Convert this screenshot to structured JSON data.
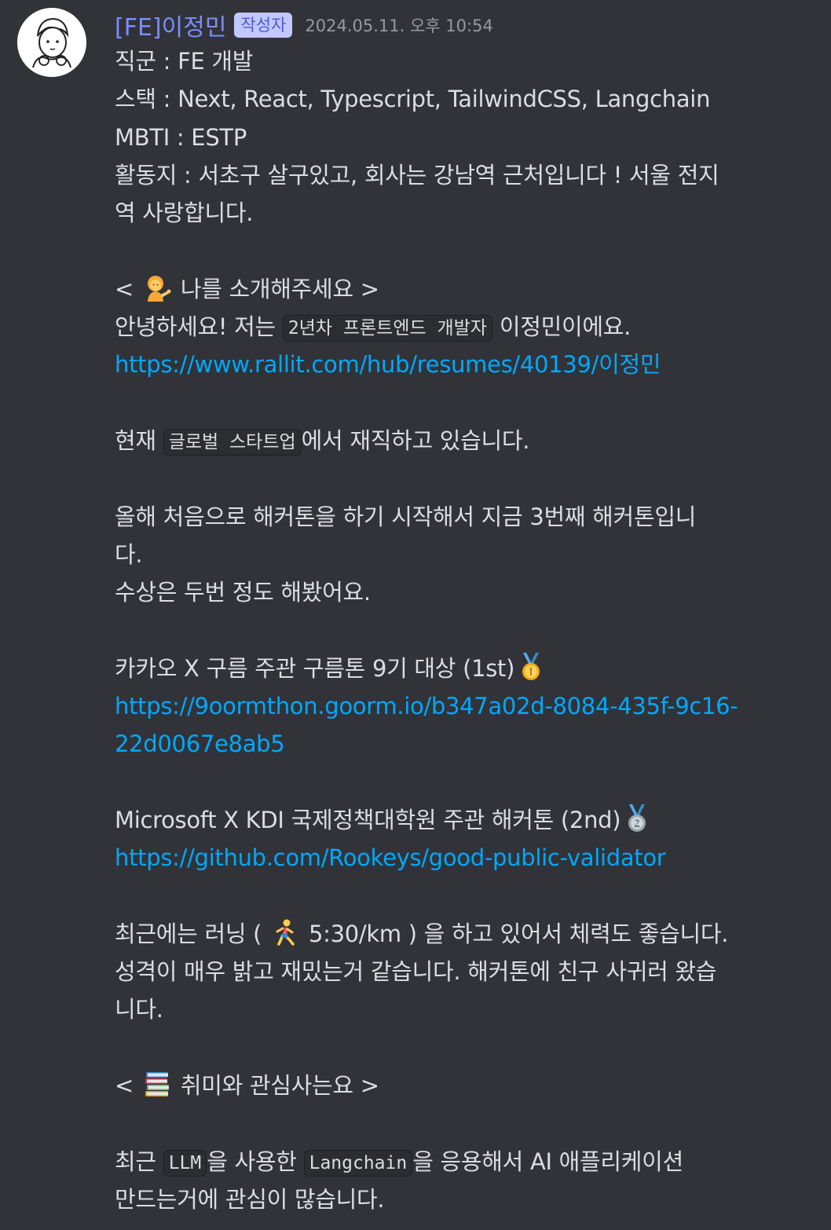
{
  "author": {
    "name": "[FE]이정민",
    "badge": "작성자",
    "timestamp": "2024.05.11. 오후 10:54",
    "color": "#7a8dff"
  },
  "profile": {
    "job": "직군 : FE 개발",
    "stack": "스택 : Next, React, Typescript, TailwindCSS, Langchain",
    "mbti": "MBTI : ESTP",
    "area_1": "활동지 : 서초구 살구있고, 회사는 강남역 근처입니다 ! 서울 전지",
    "area_2": "역 사랑합니다."
  },
  "intro": {
    "heading_prefix": "< ",
    "heading_icon": "person-tipping-hand-emoji",
    "heading_text": " 나를 소개해주세요 >",
    "greet_before": "안녕하세요! 저는 ",
    "greet_code": "2년차 프론트엔드 개발자",
    "greet_after": " 이정민이에요.",
    "resume_link": "https://www.rallit.com/hub/resumes/40139/이정민",
    "work_before": "현재 ",
    "work_code": "글로벌 스타트업",
    "work_after": "에서 재직하고 있습니다.",
    "hack_1": "올해 처음으로 해커톤을 하기 시작해서 지금 3번째 해커톤입니",
    "hack_2": "다.",
    "hack_3": " 수상은 두번 정도 해봤어요."
  },
  "awards": [
    {
      "title": "카카오 X 구름 주관 구름톤 9기 대상 (1st)",
      "icon": "gold-medal-emoji",
      "link_1": "https://9oormthon.goorm.io/b347a02d-8084-435f-9c16-",
      "link_2": "22d0067e8ab5"
    },
    {
      "title": "Microsoft X KDI 국제정책대학원 주관 해커톤 (2nd)",
      "icon": "silver-medal-emoji",
      "link_1": "https://github.com/Rookeys/good-public-validator"
    }
  ],
  "running": {
    "before": "최근에는 러닝 ( ",
    "icon": "runner-emoji",
    "after": " 5:30/km ) 을 하고 있어서 체력도 좋습니다.",
    "line_2": "성격이 매우 밝고 재밌는거 같습니다. 해커톤에 친구 사귀러 왔습",
    "line_3": "니다."
  },
  "hobby": {
    "heading_prefix": "< ",
    "heading_icon": "books-emoji",
    "heading_text": " 취미와 관심사는요 >",
    "before": "최근 ",
    "code_1": "LLM",
    "middle": "을 사용한 ",
    "code_2": "Langchain",
    "after": "을 응용해서 AI 애플리케이션",
    "line_2": "만드는거에 관심이 많습니다."
  },
  "colors": {
    "background": "#313338",
    "text": "#dbdee1",
    "link": "#00a8fc",
    "timestamp": "#949ba4",
    "badge_bg": "#c2c8ff",
    "badge_text": "#4d5bd6"
  }
}
